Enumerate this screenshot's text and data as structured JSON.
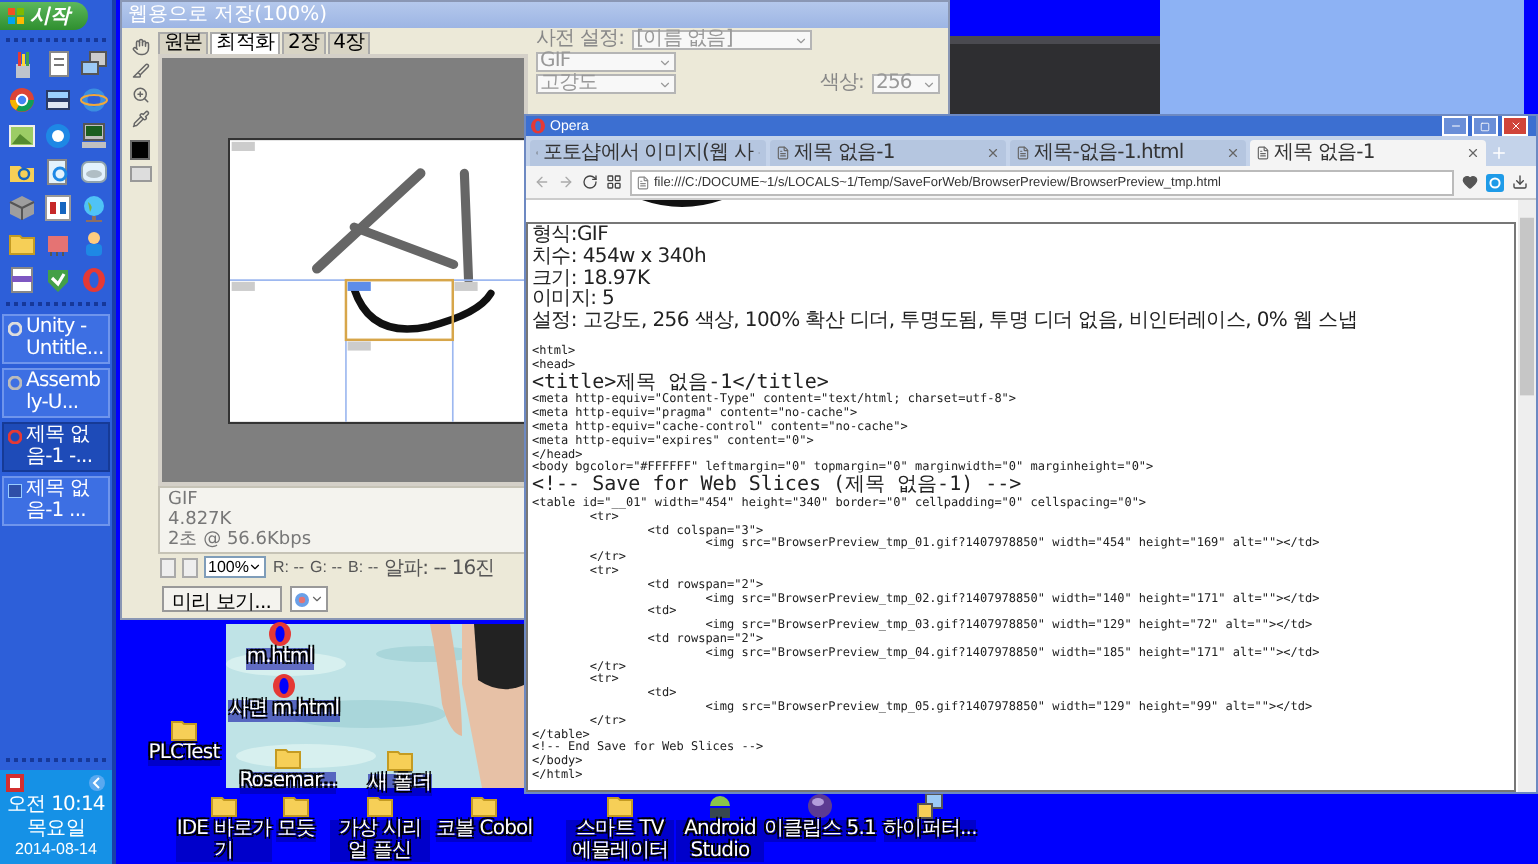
{
  "taskbar": {
    "start_label": "시작",
    "tasks": [
      {
        "label": "Unity - Untitle...",
        "selected": false
      },
      {
        "label": "Assembly-U...",
        "selected": false
      },
      {
        "label": "제목 없음-1 -...",
        "selected": true
      },
      {
        "label": "제목 없음-1 ...",
        "selected": false
      }
    ],
    "clock": {
      "time": "오전 10:14",
      "day": "목요일",
      "date": "2014-08-14"
    }
  },
  "photoshop": {
    "title": "웹용으로 저장(100%)",
    "tabs": [
      {
        "label": "원본",
        "selected": false
      },
      {
        "label": "최적화",
        "selected": true
      },
      {
        "label": "2장",
        "selected": false
      },
      {
        "label": "4장",
        "selected": false
      }
    ],
    "preset_label": "사전 설정:",
    "preset_value": "[이름 없음]",
    "format_value": "GIF",
    "reduction_value": "고강도",
    "colors_label": "색상:",
    "colors_value": "256",
    "info": [
      "GIF",
      "4.827K",
      "2초 @ 56.6Kbps"
    ],
    "zoom": "100%",
    "readouts": [
      "R: --",
      "G: --",
      "B: --"
    ],
    "alpha": "알파: --",
    "hex": "16진",
    "preview_button": "미리 보기..."
  },
  "opera": {
    "app_name": "Opera",
    "tabs": [
      {
        "label": "포토샵에서 이미지(웹 사",
        "selected": false
      },
      {
        "label": "제목 없음-1",
        "selected": false
      },
      {
        "label": "제목-없음-1.html",
        "selected": false
      },
      {
        "label": "제목 없음-1",
        "selected": true
      }
    ],
    "address": "file:///C:/DOCUME~1/s/LOCALS~1/Temp/SaveForWeb/BrowserPreview/BrowserPreview_tmp.html",
    "info_lines": [
      "형식:GIF",
      "치수: 454w x 340h",
      "크기: 18.97K",
      "이미지: 5",
      "설정: 고강도, 256 색상, 100% 확산 디더, 투명도됨, 투명 디더 없음, 비인터레이스, 0% 웹 스냅"
    ],
    "code_lines": [
      "<html>",
      "<head>",
      "<title>제목 없음-1</title>",
      "<meta http-equiv=\"Content-Type\" content=\"text/html; charset=utf-8\">",
      "<meta http-equiv=\"pragma\" content=\"no-cache\">",
      "<meta http-equiv=\"cache-control\" content=\"no-cache\">",
      "<meta http-equiv=\"expires\" content=\"0\">",
      "</head>",
      "<body bgcolor=\"#FFFFFF\" leftmargin=\"0\" topmargin=\"0\" marginwidth=\"0\" marginheight=\"0\">",
      "<!-- Save for Web Slices (제목 없음-1) -->",
      "<table id=\"__01\" width=\"454\" height=\"340\" border=\"0\" cellpadding=\"0\" cellspacing=\"0\">",
      "        <tr>",
      "                <td colspan=\"3\">",
      "                        <img src=\"BrowserPreview_tmp_01.gif?1407978850\" width=\"454\" height=\"169\" alt=\"\"></td>",
      "        </tr>",
      "        <tr>",
      "                <td rowspan=\"2\">",
      "                        <img src=\"BrowserPreview_tmp_02.gif?1407978850\" width=\"140\" height=\"171\" alt=\"\"></td>",
      "                <td>",
      "                        <img src=\"BrowserPreview_tmp_03.gif?1407978850\" width=\"129\" height=\"72\" alt=\"\"></td>",
      "                <td rowspan=\"2\">",
      "                        <img src=\"BrowserPreview_tmp_04.gif?1407978850\" width=\"185\" height=\"171\" alt=\"\"></td>",
      "        </tr>",
      "        <tr>",
      "                <td>",
      "                        <img src=\"BrowserPreview_tmp_05.gif?1407978850\" width=\"129\" height=\"99\" alt=\"\"></td>",
      "        </tr>",
      "</table>",
      "<!-- End Save for Web Slices -->",
      "</body>",
      "</html>"
    ]
  },
  "desktop_icons": [
    {
      "label": "m.html",
      "kind": "opera"
    },
    {
      "label": "사면 m.html",
      "kind": "opera"
    },
    {
      "label": "PLCTest",
      "kind": "folder"
    },
    {
      "label": "Rosemar...",
      "kind": "folder"
    },
    {
      "label": "새 폴더",
      "kind": "folder"
    },
    {
      "label": "IDE 바로가기",
      "kind": "folder"
    },
    {
      "label": "모듯",
      "kind": "folder"
    },
    {
      "label": "가상 시리얼 플신",
      "kind": "folder"
    },
    {
      "label": "코볼 Cobol",
      "kind": "folder"
    },
    {
      "label": "스마트 TV 에뮬레이터",
      "kind": "folder"
    },
    {
      "label": "Android Studio",
      "kind": "android"
    },
    {
      "label": "이클립스 5.1",
      "kind": "eclipse"
    },
    {
      "label": "하이퍼터...",
      "kind": "network"
    }
  ]
}
